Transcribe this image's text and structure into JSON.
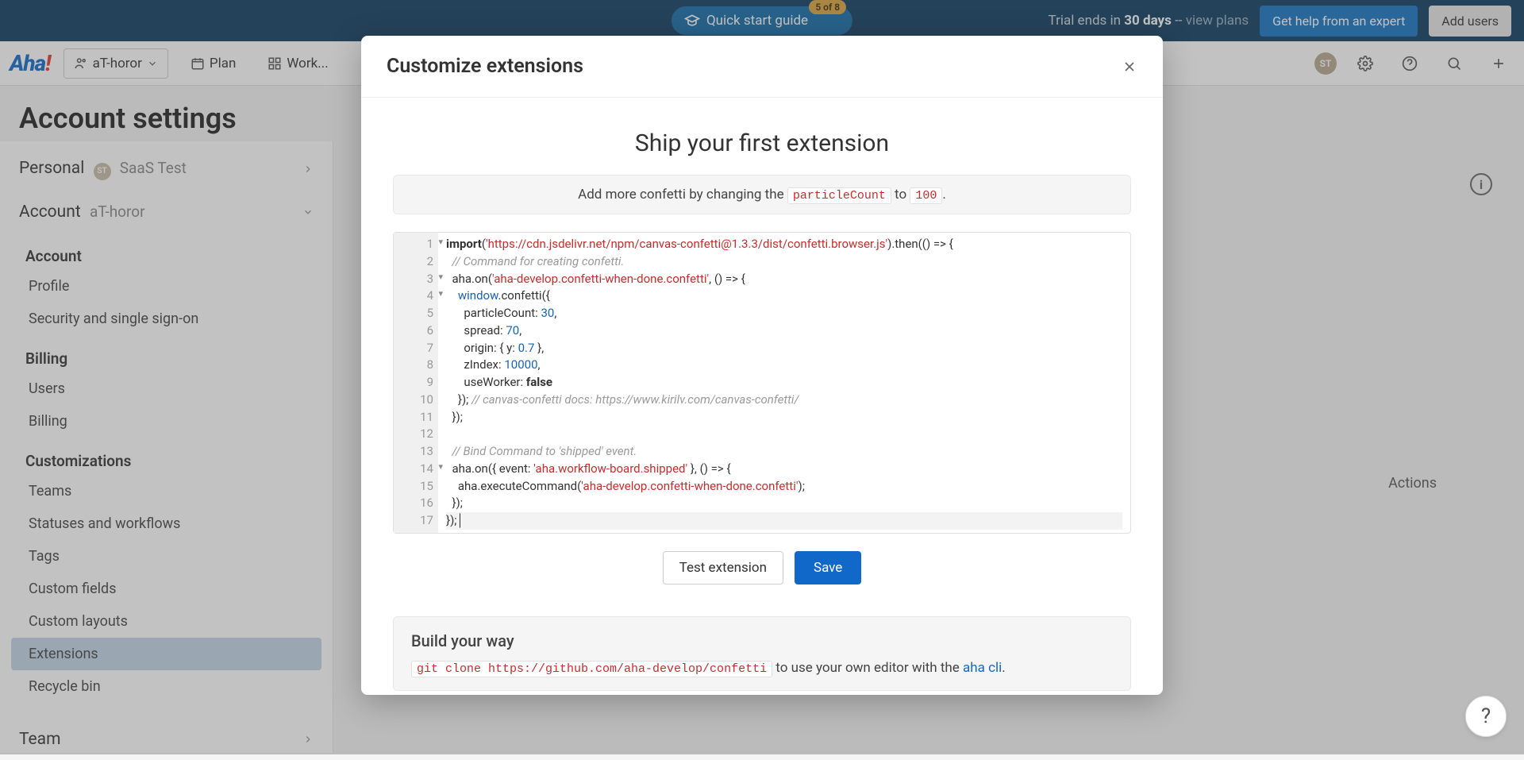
{
  "topbar": {
    "quick_start": "Quick start guide",
    "quick_start_badge": "5 of 8",
    "trial_prefix": "Trial ends in ",
    "trial_days": "30 days",
    "trial_suffix": " -- ",
    "view_plans": "view plans",
    "get_help": "Get help from an expert",
    "add_users": "Add users"
  },
  "nav": {
    "workspace": "aT-horor",
    "plan": "Plan",
    "work": "Work...",
    "avatar": "ST"
  },
  "page": {
    "title": "Account settings"
  },
  "sidebar": {
    "personal": "Personal",
    "personal_user_initials": "ST",
    "personal_user": "SaaS Test",
    "account": "Account",
    "account_ws": "aT-horor",
    "team": "Team",
    "groups": {
      "account": "Account",
      "billing": "Billing",
      "customizations": "Customizations"
    },
    "links": {
      "profile": "Profile",
      "security": "Security and single sign-on",
      "users": "Users",
      "billing": "Billing",
      "teams": "Teams",
      "statuses": "Statuses and workflows",
      "tags": "Tags",
      "custom_fields": "Custom fields",
      "custom_layouts": "Custom layouts",
      "extensions": "Extensions",
      "recycle": "Recycle bin"
    }
  },
  "main": {
    "actions_header": "Actions"
  },
  "modal": {
    "title": "Customize extensions",
    "ship_title": "Ship your first extension",
    "hint_prefix": "Add more confetti by changing the ",
    "hint_code": "particleCount",
    "hint_mid": " to ",
    "hint_val": "100",
    "hint_suffix": ".",
    "test_btn": "Test extension",
    "save_btn": "Save",
    "build_title": "Build your way",
    "git_cmd": "git clone https://github.com/aha-develop/confetti",
    "build_mid": " to use your own editor with the ",
    "aha_cli": "aha cli",
    "build_end": "."
  },
  "code": {
    "l1a": "import",
    "l1b": "'https://cdn.jsdelivr.net/npm/canvas-confetti@1.3.3/dist/confetti.browser.js'",
    "l1c": ").then(() => {",
    "l2": "// Command for creating confetti.",
    "l3a": "  aha.on(",
    "l3b": "'aha-develop.confetti-when-done.confetti'",
    "l3c": ", () => {",
    "l4a": "window",
    "l4b": ".confetti({",
    "l5a": "      particleCount: ",
    "l5b": "30",
    "l6a": "      spread: ",
    "l6b": "70",
    "l7a": "      origin: { y: ",
    "l7b": "0.7",
    "l7c": " },",
    "l8a": "      zIndex: ",
    "l8b": "10000",
    "l9a": "      useWorker: ",
    "l9b": "false",
    "l10a": "    }); ",
    "l10b": "// canvas-confetti docs: https://www.kirilv.com/canvas-confetti/",
    "l11": "  });",
    "l12": "",
    "l13": "// Bind Command to 'shipped' event.",
    "l14a": "  aha.on({ event: ",
    "l14b": "'aha.workflow-board.shipped'",
    "l14c": " }, () => {",
    "l15a": "    aha.executeCommand(",
    "l15b": "'aha-develop.confetti-when-done.confetti'",
    "l15c": ");",
    "l16": "  });",
    "l17": "});"
  }
}
